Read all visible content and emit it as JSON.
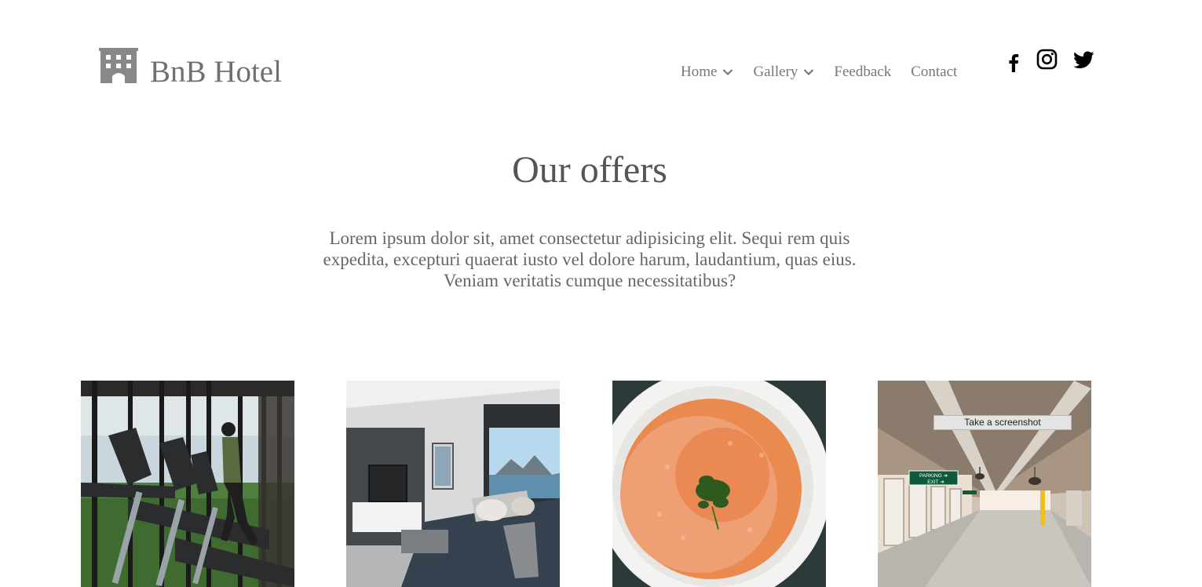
{
  "brand": {
    "name": "BnB Hotel",
    "icon": "hotel-building-icon"
  },
  "nav": {
    "items": [
      {
        "label": "Home",
        "has_dropdown": true
      },
      {
        "label": "Gallery",
        "has_dropdown": true
      },
      {
        "label": "Feedback",
        "has_dropdown": false
      },
      {
        "label": "Contact",
        "has_dropdown": false
      }
    ]
  },
  "social": {
    "icons": [
      "facebook-icon",
      "instagram-icon",
      "twitter-icon"
    ]
  },
  "offers": {
    "title": "Our offers",
    "description": "Lorem ipsum dolor sit, amet consectetur adipisicing elit. Sequi rem quis expedita, excepturi quaerat iusto vel dolore harum, laudantium, quas eius. Veniam veritatis cumque necessitatibus?",
    "cards": [
      {
        "image": "gym-treadmill-photo"
      },
      {
        "image": "living-room-photo"
      },
      {
        "image": "soup-bowl-photo"
      },
      {
        "image": "parking-garage-photo",
        "sign_text": "PARKING\nEXIT"
      }
    ]
  },
  "tooltip": {
    "label": "Take a screenshot"
  },
  "colors": {
    "text_gray": "#707070",
    "nav_gray": "#777777",
    "heading": "#555555",
    "social": "#000000"
  }
}
